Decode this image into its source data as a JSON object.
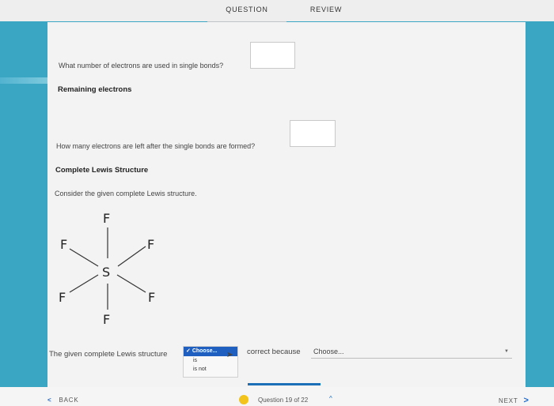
{
  "tabs": {
    "question": "QUESTION",
    "review": "REVIEW"
  },
  "q1": {
    "text": "What number of electrons are used in single bonds?",
    "value": ""
  },
  "section_remaining": "Remaining electrons",
  "q2": {
    "text": "How many electrons are left after the single bonds are formed?",
    "value": ""
  },
  "section_complete": "Complete Lewis Structure",
  "consider": "Consider the given complete Lewis structure.",
  "lewis": {
    "atoms": {
      "center": "S",
      "top": "F",
      "bottom": "F",
      "upper_left": "F",
      "upper_right": "F",
      "lower_left": "F",
      "lower_right": "F"
    }
  },
  "sentence": {
    "start": "The given complete Lewis structure",
    "mid": "correct because",
    "dropdown1": {
      "selected": "Choose...",
      "options": [
        "is",
        "is not"
      ]
    },
    "dropdown2_selected": "Choose..."
  },
  "footer": {
    "back": "BACK",
    "counter": "Question 19 of 22",
    "next": "NEXT"
  },
  "icons": {
    "back": "chevron-left-icon",
    "next": "chevron-right-icon",
    "expand": "caret-up-icon",
    "status": "status-dot-icon"
  },
  "colors": {
    "accent": "#1a6fb6",
    "background": "#3aa6c4",
    "dot": "#f2c31b",
    "selected": "#1f5fbf"
  }
}
